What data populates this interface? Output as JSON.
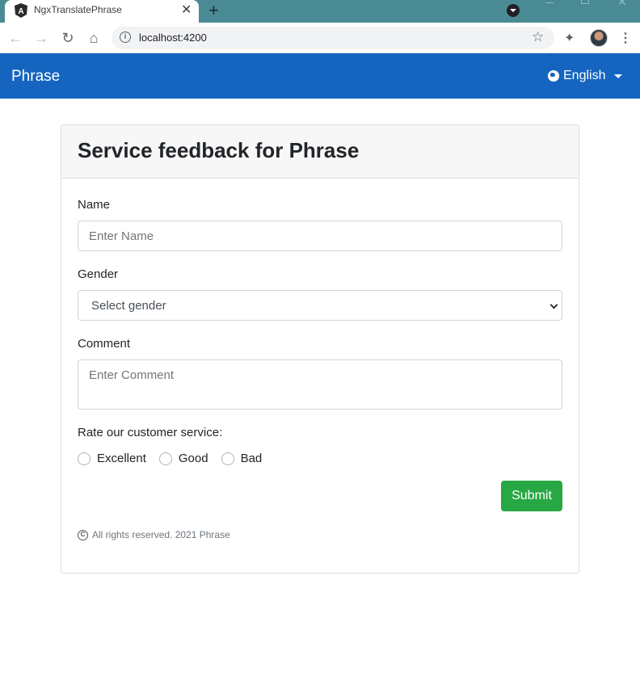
{
  "browser": {
    "tab_title": "NgxTranslatePhrase",
    "url": "localhost:4200"
  },
  "navbar": {
    "brand": "Phrase",
    "language": "English"
  },
  "form": {
    "title": "Service feedback for Phrase",
    "name_label": "Name",
    "name_placeholder": "Enter Name",
    "gender_label": "Gender",
    "gender_selected": "Select gender",
    "comment_label": "Comment",
    "comment_placeholder": "Enter Comment",
    "rating_label": "Rate our customer service:",
    "rating_options": [
      "Excellent",
      "Good",
      "Bad"
    ],
    "submit_label": "Submit",
    "footer": "All rights reserved. 2021 Phrase"
  },
  "colors": {
    "navbar": "#1565c0",
    "submit": "#28a745",
    "tabstrip": "#4a8a95"
  }
}
